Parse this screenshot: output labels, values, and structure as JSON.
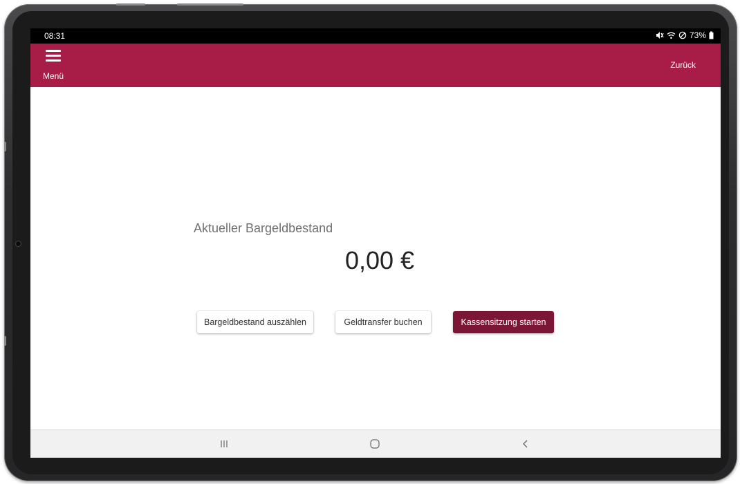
{
  "status_bar": {
    "time": "08:31",
    "battery": "73%"
  },
  "app_bar": {
    "menu_label": "Menü",
    "back_label": "Zurück"
  },
  "cash": {
    "label": "Aktueller Bargeldbestand",
    "amount": "0,00 €"
  },
  "actions": {
    "count_cash": "Bargeldbestand auszählen",
    "book_transfer": "Geldtransfer buchen",
    "start_session": "Kassensitzung starten"
  },
  "colors": {
    "app_bar": "#a81c48",
    "primary_button": "#7b1637",
    "nav_bar": "#f1f1f1"
  },
  "icons": {
    "menu": "hamburger-icon",
    "mute": "mute-icon",
    "wifi": "wifi-icon",
    "dnd": "do-not-disturb-icon",
    "battery": "battery-icon",
    "nav_recent": "recent-apps-icon",
    "nav_home": "home-icon",
    "nav_back": "back-icon"
  }
}
